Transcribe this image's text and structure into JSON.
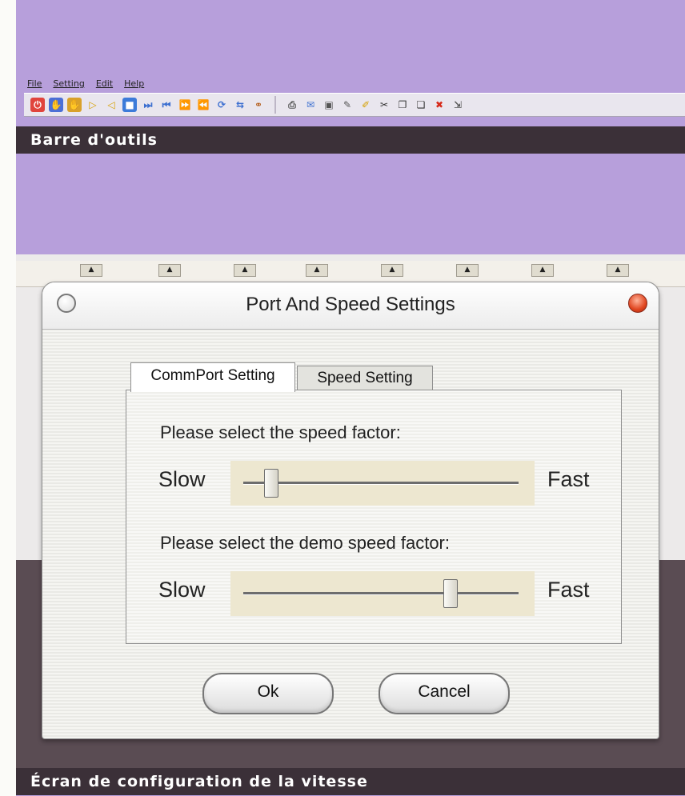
{
  "menubar": {
    "items": [
      "File",
      "Setting",
      "Edit",
      "Help"
    ]
  },
  "captions": {
    "toolbar": "Barre d'outils",
    "screen": "Écran de configuration de la vitesse"
  },
  "dialog": {
    "title": "Port And Speed Settings",
    "tabs": [
      "CommPort Setting",
      "Speed Setting"
    ],
    "speed_label": "Please select the speed factor:",
    "demo_label": "Please select the demo speed factor:",
    "slow": "Slow",
    "fast": "Fast",
    "speed_value": 0.1,
    "demo_speed_value": 0.75,
    "ok": "Ok",
    "cancel": "Cancel"
  },
  "toolbar_icons": [
    "power-icon",
    "hand-icon",
    "hand-icon",
    "play-icon",
    "reverse-icon",
    "stop-icon",
    "skip-end-icon",
    "skip-start-icon",
    "fast-forward-icon",
    "rewind-icon",
    "loop-icon",
    "swap-icon",
    "binoculars-icon",
    "print-icon",
    "open-icon",
    "save-icon",
    "edit-icon",
    "pencil-icon",
    "cut-icon",
    "copy-icon",
    "paste-icon",
    "delete-icon",
    "export-icon"
  ],
  "colors": {
    "background": "#b79fdb",
    "caption_bar": "#3b3038",
    "close_button": "#e0451f"
  }
}
